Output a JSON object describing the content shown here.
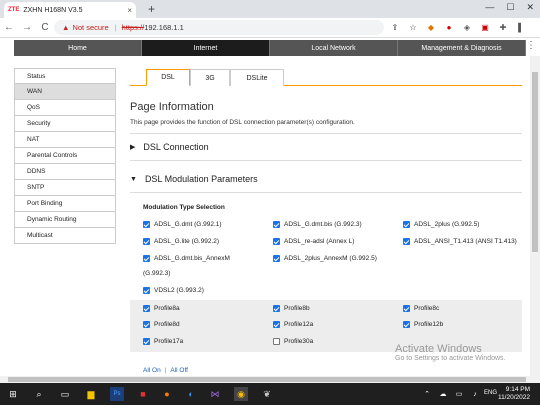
{
  "browser": {
    "tab_favicon": "ZTE",
    "tab_title": "ZXHN H168N V3.5",
    "tab_close": "×",
    "new_tab": "+",
    "win_min": "—",
    "win_max": "☐",
    "win_close": "✕",
    "back": "←",
    "forward": "→",
    "reload": "C",
    "security_icon": "warning-triangle-icon",
    "not_secure": "Not secure",
    "url_scheme": "https://",
    "url_host": "192.168.1.1",
    "extensions_menu": "⋮"
  },
  "topnav": {
    "items": [
      "Home",
      "Internet",
      "Local Network",
      "Management & Diagnosis"
    ],
    "active": "Internet"
  },
  "sidebar": {
    "items": [
      "Status",
      "WAN",
      "QoS",
      "Security",
      "NAT",
      "Parental Controls",
      "DDNS",
      "SNTP",
      "Port Binding",
      "Dynamic Routing",
      "Multicast"
    ],
    "active": "WAN"
  },
  "subtabs": {
    "items": [
      "DSL",
      "3G",
      "DSLite"
    ],
    "active": "DSL"
  },
  "page": {
    "title": "Page Information",
    "description": "This page provides the function of DSL connection parameter(s) configuration.",
    "section_dsl_connection": "DSL Connection",
    "section_modulation": "DSL Modulation Parameters",
    "modulation_type_title": "Modulation Type Selection"
  },
  "modulation": {
    "adsl_g_dmt": "ADSL_G.dmt (G.992.1)",
    "adsl_g_dmt_bis": "ADSL_G.dmt.bis (G.992.3)",
    "adsl_2plus": "ADSL_2plus (G.992.5)",
    "adsl_g_lite": "ADSL_G.lite (G.992.2)",
    "adsl_re_adsl": "ADSL_re-adsl (Annex L)",
    "adsl_ansi": "ADSL_ANSI_T1.413 (ANSI T1.413)",
    "adsl_g_dmt_bis_annexm": "ADSL_G.dmt.bis_AnnexM",
    "adsl_g_dmt_bis_annexm_2": "(G.992.3)",
    "adsl_2plus_annexm": "ADSL_2plus_AnnexM (G.992.5)",
    "vdsl2": "VDSL2 (G.993.2)"
  },
  "profiles": {
    "p8a": "Profile8a",
    "p8b": "Profile8b",
    "p8c": "Profile8c",
    "p8d": "Profile8d",
    "p12a": "Profile12a",
    "p12b": "Profile12b",
    "p17a": "Profile17a",
    "p30a": "Profile30a"
  },
  "links": {
    "all_on": "All On",
    "separator": "|",
    "all_off": "All Off"
  },
  "watermark": {
    "line1": "Activate Windows",
    "line2": "Go to Settings to activate Windows."
  },
  "taskbar": {
    "start_icon": "windows-start-icon",
    "language": "ENG",
    "time": "9:14 PM",
    "date": "11/20/2022"
  },
  "colors": {
    "accent_orange": "#ff9a00",
    "checkbox_blue": "#1a73e8",
    "nav_dark": "#1c1c1c",
    "not_secure_red": "#c5221f"
  }
}
